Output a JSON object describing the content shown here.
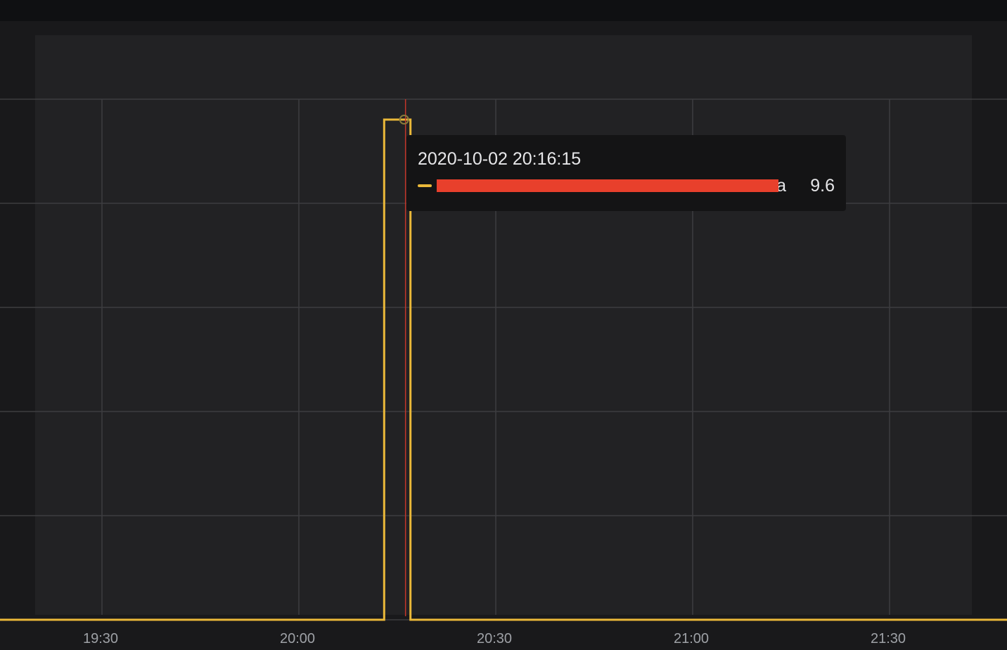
{
  "panel": {
    "tooltip": {
      "time": "2020-10-02 20:16:15",
      "series_name": "a",
      "series_value": "9.6"
    }
  },
  "colors": {
    "series": "#eab839",
    "cursor": "#c4352a",
    "redaction": "#e8402c",
    "grid": "#3d3d40"
  },
  "chart_data": {
    "type": "line",
    "step": true,
    "grid": true,
    "x_ticks": [
      "19:30",
      "20:00",
      "20:30",
      "21:00",
      "21:30"
    ],
    "x_tick_minutes": [
      1170,
      1200,
      1230,
      1260,
      1290
    ],
    "y_gridlines": 6,
    "series": [
      {
        "points": [
          {
            "x": "20:13",
            "y": 0
          },
          {
            "x": "20:13",
            "y": 9.6
          },
          {
            "x": "20:17",
            "y": 9.6
          },
          {
            "x": "20:17",
            "y": 0
          }
        ]
      }
    ],
    "hover": {
      "x": "20:16:15",
      "y": 9.6
    }
  }
}
